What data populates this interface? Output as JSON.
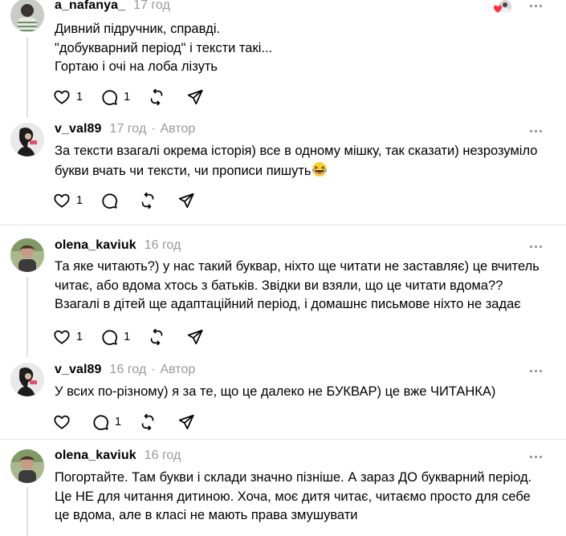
{
  "posts": [
    {
      "username": "a_nafanya_",
      "time": "17 год",
      "author": "",
      "lines": [
        "Дивний підручник, справді.",
        "\"добукварний період\" і тексти такі...",
        "Гортаю і очі на лоба лізуть"
      ],
      "likes": "1",
      "replies": "1"
    },
    {
      "username": "v_val89",
      "time": "17 год",
      "author": "Автор",
      "lines": [
        "За тексти взагалі окрема історія) все в одному мішку, так сказати) незрозуміло",
        "букви вчать чи тексти, чи прописи пишуть"
      ],
      "emoji": "grinning-tears-emoji",
      "likes": "1",
      "replies": ""
    },
    {
      "username": "olena_kaviuk",
      "time": "16 год",
      "author": "",
      "lines": [
        "Та яке читають?) у нас такий буквар, ніхто ще читати не заставляє) це вчитель",
        "читає, або вдома хтось з батьків. Звідки ви взяли, що це читати вдома??",
        "Взагалі в дітей ще адаптаційний період, і домашнє письмове ніхто не задає"
      ],
      "likes": "1",
      "replies": "1"
    },
    {
      "username": "v_val89",
      "time": "16 год",
      "author": "Автор",
      "lines": [
        "У всих по-різному) я за те, що це далеко не БУКВАР) це вже ЧИТАНКА)"
      ],
      "likes": "",
      "replies": "1"
    },
    {
      "username": "olena_kaviuk",
      "time": "16 год",
      "author": "",
      "lines": [
        "Погортайте. Там букви і склади значно пізніше. А зараз ДО букварний період.",
        "Це НЕ для читання дитиною. Хоча, моє дитя читає, читаємо просто для себе",
        "це вдома, але в класі не мають права змушувати"
      ],
      "likes": "",
      "replies": ""
    }
  ],
  "separator": "·",
  "icons": {
    "like": "heart-icon",
    "reply": "comment-icon",
    "repost": "repost-icon",
    "share": "send-icon",
    "more": "more-icon"
  },
  "colors": {
    "muted": "#9a9a9a",
    "liked_heart": "#ff3040"
  }
}
